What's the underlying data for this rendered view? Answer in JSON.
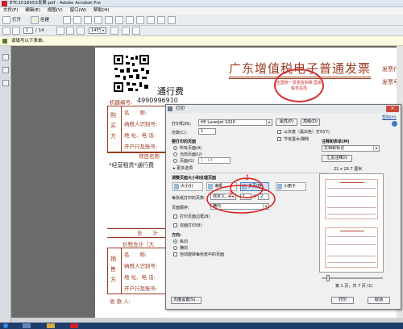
{
  "window": {
    "title": "ETC2018053发票.pdf - Adobe Acrobat Pro"
  },
  "menu": [
    "文件(F)",
    "编辑(E)",
    "视图(V)",
    "窗口(W)",
    "帮助(H)"
  ],
  "toolbar": {
    "open_label": "打开",
    "create_label": "创建",
    "page_current": "1",
    "page_total": "/ 14",
    "zoom": "145%"
  },
  "message": {
    "text": "请填写以下表单。"
  },
  "invoice": {
    "title": "广东增值税电子普通发票",
    "stamp_text": "全国统一发票监制章 国家税务总局",
    "service": "通行费",
    "machine_no_label": "机器编号:",
    "machine_no": "4990996910",
    "right_label_1": "发票代",
    "right_label_2": "发票号",
    "buyer_side": "购买方",
    "buyer_fields": [
      "名　　称:",
      "纳税人识别号:",
      "地 址、电 话:",
      "开户行及账号:"
    ],
    "item_header": "项目名称",
    "item_name": "*经营租赁*通行费",
    "total_label": "合　　计",
    "total_in_words_label": "价税合计（大",
    "seller_side": "销售方",
    "seller_fields": [
      "名　　称:",
      "纳税人识别号:",
      "地 址、电 话:",
      "开户行及账号:"
    ],
    "payee_label": "收 款 人:"
  },
  "dialog": {
    "title": "打印",
    "printer_label": "打印机(N):",
    "printer_value": "HP LaserJet 1020",
    "properties_btn": "属性(P)",
    "advanced_btn": "高级(D)",
    "help_link": "帮助(H)",
    "copies_label": "份数(C):",
    "copies_value": "1",
    "grayscale_label": "以灰度（黑白色）打印(Y)",
    "save_ink_label": "节省墨水/碳粉",
    "range_title": "要打印的页面",
    "range_all": "所有页面(A)",
    "range_current": "当前页面(U)",
    "range_pages": "页面(G)",
    "range_pages_value": "1 - 14",
    "more_options": "▸ 更多选项",
    "sizing_title": "调整页面大小和处理页面",
    "tiles": [
      "大小(I)",
      "海报",
      "多页(M)",
      "小册子"
    ],
    "pages_per_sheet_label": "每张纸打印的页数:",
    "pages_per_sheet_value": "自定义...",
    "pps_x": "1",
    "pps_times": "X",
    "pps_y": "2",
    "page_order_label": "页面顺序:",
    "page_order_value": "横向",
    "print_borders_label": "打印页面边框(B)",
    "double_sided_label": "双面打印(B)",
    "orientation_title": "方向:",
    "orient_portrait": "纵向",
    "orient_landscape": "横向",
    "orient_auto": "自动旋转每张纸中的页面",
    "comments_title": "注释和表单(M)",
    "comments_value": "文档和标记",
    "summarize_btn": "汇总注释(I)",
    "paper_size": "21 x 29.7 厘米",
    "page_count": "第 1 页，共 7 页 (1)",
    "page_setup_btn": "页面设置(S)...",
    "print_btn": "打印",
    "cancel_btn": "取消",
    "annotations": [
      "1",
      "2"
    ]
  }
}
